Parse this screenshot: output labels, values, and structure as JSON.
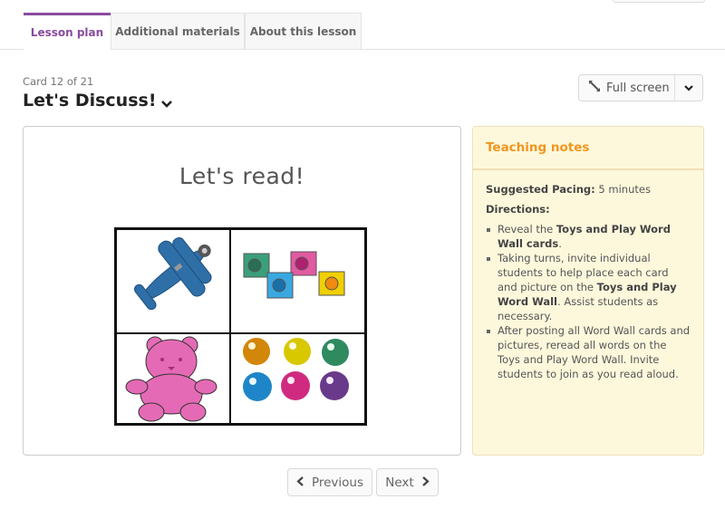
{
  "tabs": [
    {
      "label": "Lesson plan",
      "active": true
    },
    {
      "label": "Additional materials",
      "active": false
    },
    {
      "label": "About this lesson",
      "active": false
    }
  ],
  "card": {
    "counter": "Card 12 of 21",
    "title": "Let's Discuss!"
  },
  "toolbar": {
    "fullscreen_label": "Full screen",
    "fullscreen_icon": "expand-arrows-icon",
    "menu_icon": "chevron-down-icon"
  },
  "slide": {
    "title": "Let's read!",
    "pictures": [
      {
        "name": "airplane",
        "color": "#2f6fa8"
      },
      {
        "name": "blocks",
        "colors": [
          "#3aa07a",
          "#e25aa0",
          "#3aa8e0",
          "#f0d000"
        ]
      },
      {
        "name": "teddy-bear",
        "color": "#e56ab5"
      },
      {
        "name": "marbles",
        "colors": [
          "#d2860a",
          "#d8c800",
          "#2f8a60",
          "#1e86c8",
          "#d02a80",
          "#6a3a8a"
        ]
      }
    ]
  },
  "notes": {
    "heading": "Teaching notes",
    "pacing_label": "Suggested Pacing:",
    "pacing_value": " 5 minutes",
    "directions_label": "Directions:",
    "items": [
      {
        "pre": "Reveal the ",
        "bold": "Toys and Play Word Wall cards",
        "post": "."
      },
      {
        "pre": "Taking turns, invite individual students to help place each card and picture on the ",
        "bold": "Toys and Play Word Wall",
        "post": ". Assist students as necessary."
      },
      {
        "pre": "After posting all Word Wall cards and pictures, reread all words on the Toys and Play Word Wall. Invite students to join as you read aloud.",
        "bold": "",
        "post": ""
      }
    ],
    "colors": {
      "heading": "#f0961e",
      "background": "#fdf8dc"
    }
  },
  "pager": {
    "previous_label": "Previous",
    "next_label": "Next"
  },
  "accent_color": "#8a4a9e"
}
